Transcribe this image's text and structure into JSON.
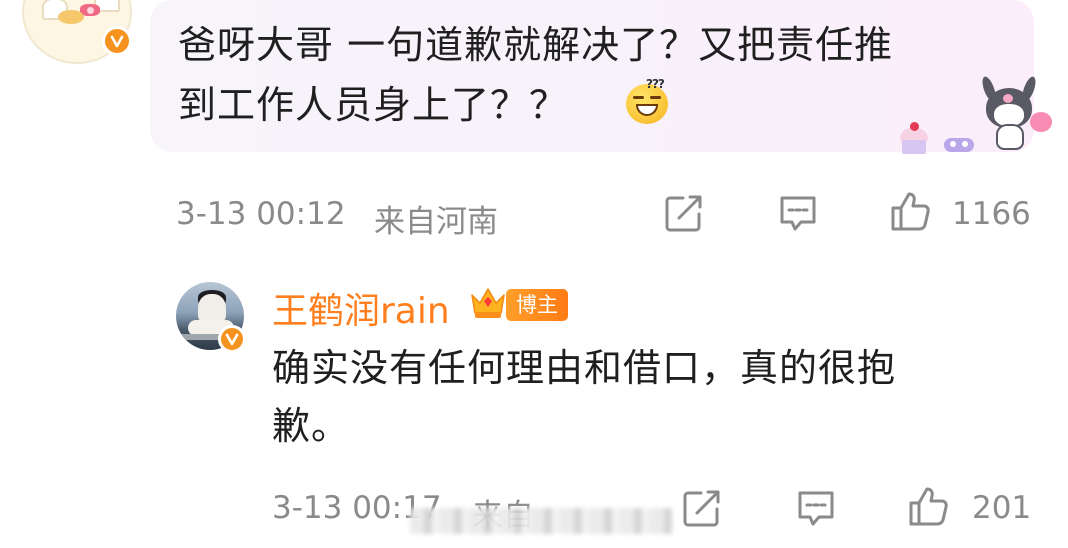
{
  "top_comment": {
    "text_line1": "爸呀大哥 一句道歉就解决了？又把责任推",
    "text_line2": "到工作人员身上了？？",
    "emoji": "confused-smile-emoji",
    "timestamp": "3-13 00:12",
    "location": "来自河南",
    "like_count": "1166"
  },
  "reply": {
    "username": "王鹤润rain",
    "badge_label": "博主",
    "text_line1": "确实没有任何理由和借口，真的很抱",
    "text_line2": "歉。",
    "timestamp": "3-13 00:17",
    "location_partial": "来自",
    "like_count": "201"
  },
  "icons": {
    "share": "share-icon",
    "comment": "comment-icon",
    "like": "thumbs-up-icon",
    "verified": "verified-v-icon",
    "crown": "crown-icon"
  },
  "colors": {
    "accent_orange": "#ff7f1e",
    "verified_orange": "#f6931f",
    "meta_gray": "#8a8a8a",
    "bubble_bg": "#f8f1fb"
  }
}
